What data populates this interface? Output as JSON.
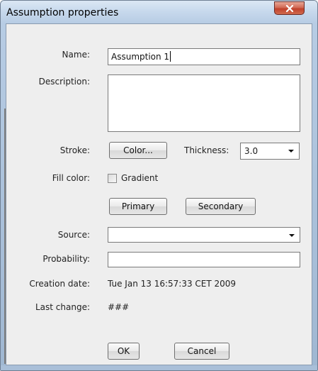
{
  "window": {
    "title": "Assumption properties",
    "close_icon": "close-icon"
  },
  "form": {
    "name_label": "Name:",
    "name_value": "Assumption 1",
    "description_label": "Description:",
    "description_value": "",
    "stroke_label": "Stroke:",
    "color_button": "Color...",
    "thickness_label": "Thickness:",
    "thickness_value": "3.0",
    "fill_color_label": "Fill color:",
    "gradient_label": "Gradient",
    "gradient_checked": false,
    "primary_button": "Primary",
    "secondary_button": "Secondary",
    "source_label": "Source:",
    "source_value": "",
    "probability_label": "Probability:",
    "probability_value": "",
    "creation_date_label": "Creation date:",
    "creation_date_value": "Tue Jan 13 16:57:33 CET 2009",
    "last_change_label": "Last change:",
    "last_change_value": "###"
  },
  "footer": {
    "ok_button": "OK",
    "cancel_button": "Cancel"
  }
}
